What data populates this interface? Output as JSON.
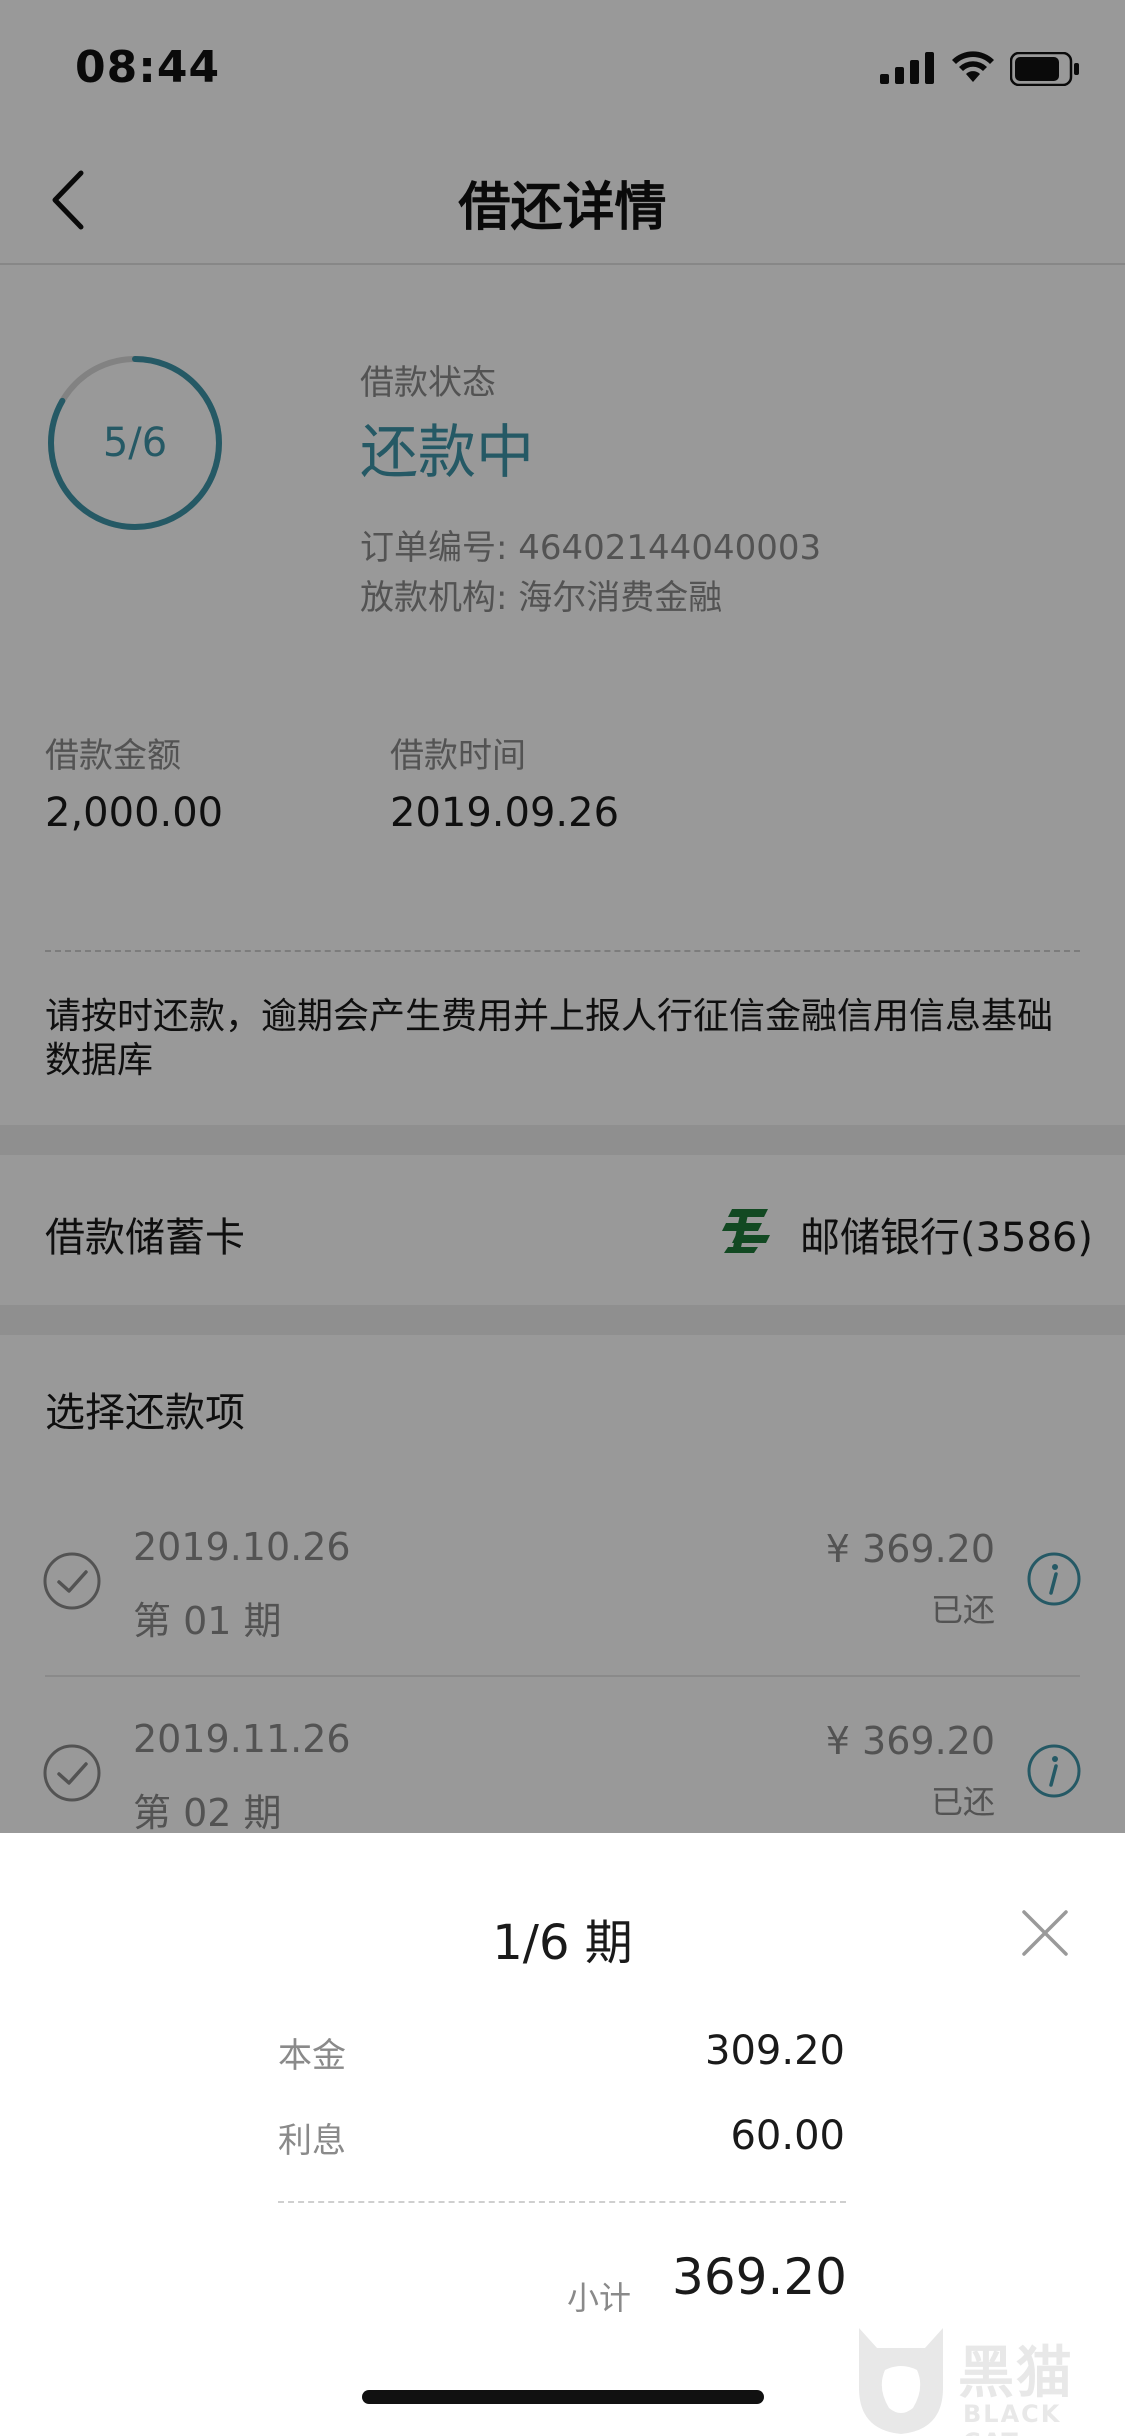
{
  "status_bar": {
    "time": "08:44"
  },
  "nav": {
    "title": "借还详情"
  },
  "loan_status": {
    "progress": "5/6",
    "progress_fraction": 0.8333,
    "label": "借款状态",
    "value": "还款中",
    "order_no": "订单编号: 46402144040003",
    "lender": "放款机构: 海尔消费金融"
  },
  "loan_info": {
    "amount_label": "借款金额",
    "amount_value": "2,000.00",
    "date_label": "借款时间",
    "date_value": "2019.09.26"
  },
  "notice": "请按时还款，逾期会产生费用并上报人行征信金融信用信息基础数据库",
  "card": {
    "label": "借款储蓄卡",
    "bank": "邮储银行(3586)"
  },
  "repay": {
    "section_title": "选择还款项",
    "items": [
      {
        "date": "2019.10.26",
        "period": "第 01 期",
        "amount": "¥ 369.20",
        "state": "已还"
      },
      {
        "date": "2019.11.26",
        "period": "第 02 期",
        "amount": "¥ 369.20",
        "state": "已还"
      }
    ]
  },
  "sheet": {
    "title": "1/6 期",
    "principal_label": "本金",
    "principal_value": "309.20",
    "interest_label": "利息",
    "interest_value": "60.00",
    "subtotal_label": "小计",
    "subtotal_value": "369.20"
  },
  "watermark": {
    "text": "黑猫",
    "sub": "BLACK CAT"
  },
  "colors": {
    "accent": "#3e95a8",
    "bank_green": "#1f7a3a"
  }
}
